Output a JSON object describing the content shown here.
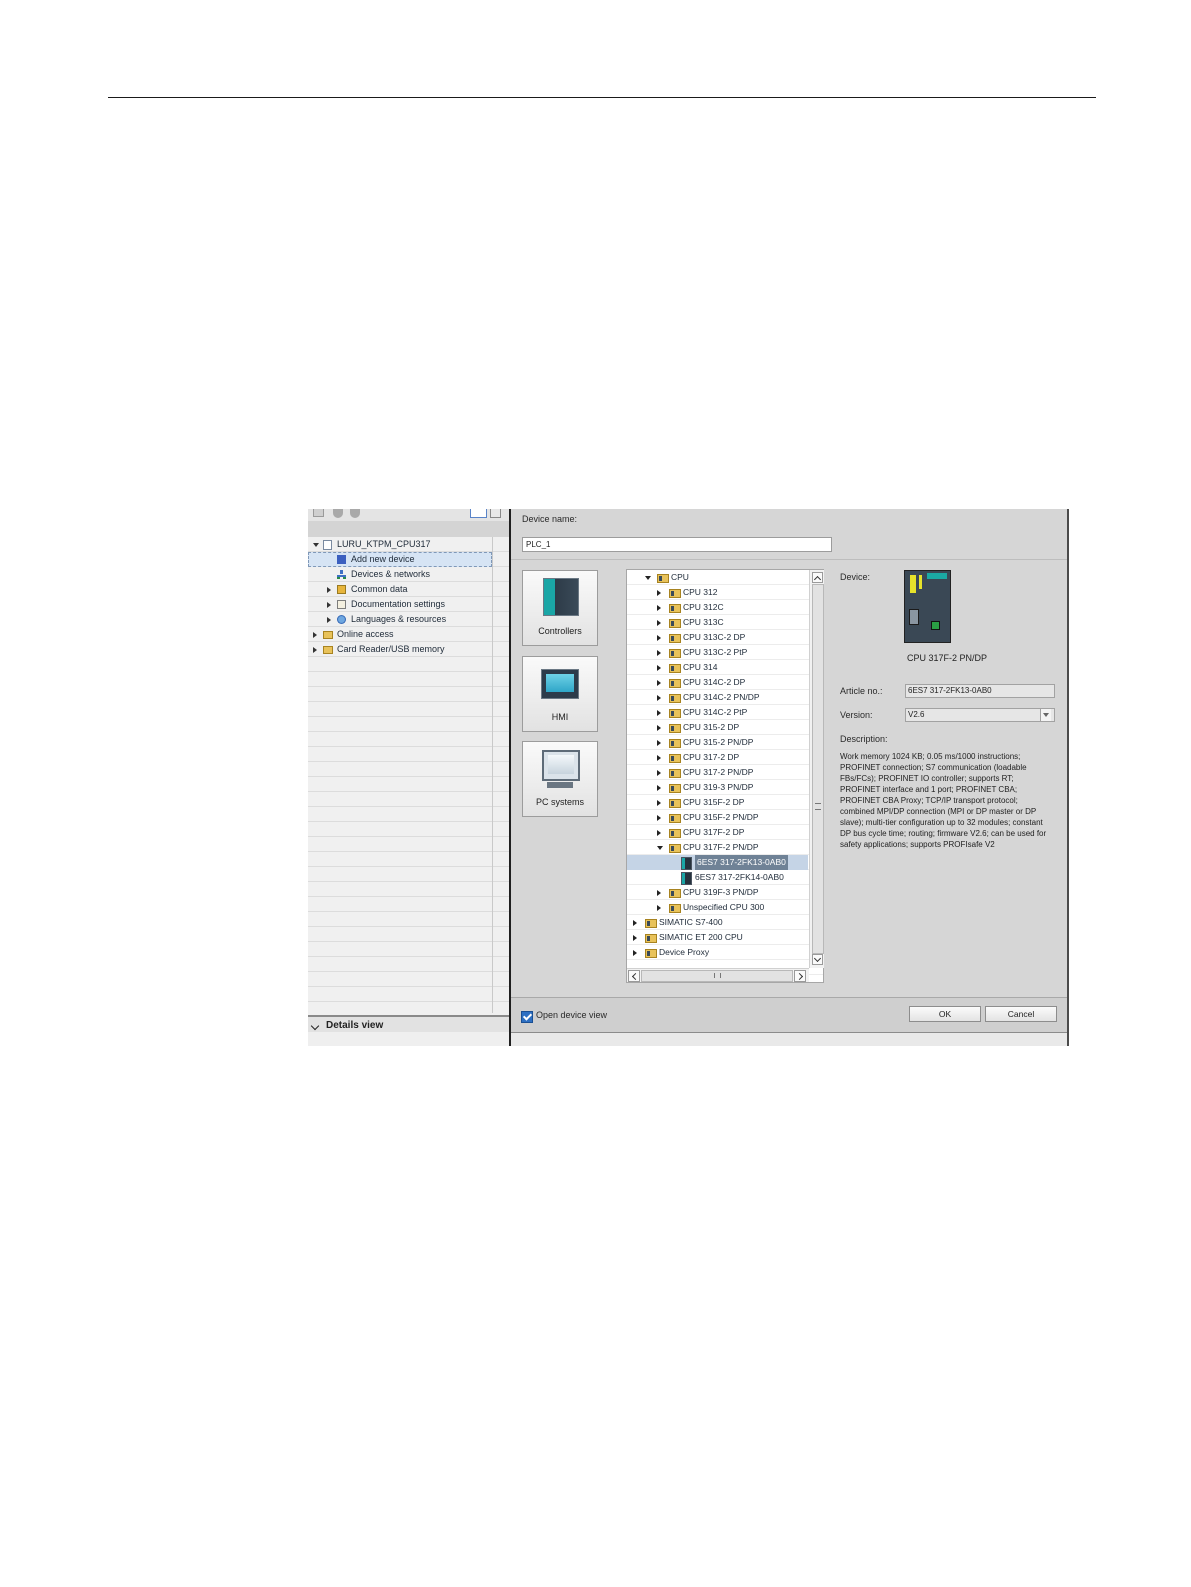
{
  "project_tree": {
    "items": [
      {
        "label": "LURU_KTPM_CPU317",
        "level": 0,
        "state": "expanded",
        "icon": "project-icon"
      },
      {
        "label": "Add new device",
        "level": 1,
        "state": "leaf",
        "icon": "add-device-icon",
        "selected": true
      },
      {
        "label": "Devices & networks",
        "level": 1,
        "state": "leaf",
        "icon": "network-icon"
      },
      {
        "label": "Common data",
        "level": 1,
        "state": "collapsed",
        "icon": "common-data-icon"
      },
      {
        "label": "Documentation settings",
        "level": 1,
        "state": "collapsed",
        "icon": "documentation-icon"
      },
      {
        "label": "Languages & resources",
        "level": 1,
        "state": "collapsed",
        "icon": "languages-icon"
      },
      {
        "label": "Online access",
        "level": 0,
        "state": "collapsed",
        "icon": "online-access-icon"
      },
      {
        "label": "Card Reader/USB memory",
        "level": 0,
        "state": "collapsed",
        "icon": "card-reader-icon"
      }
    ],
    "details_view_label": "Details view"
  },
  "dialog": {
    "device_name_label": "Device name:",
    "device_name_value": "PLC_1",
    "categories": [
      {
        "label": "Controllers",
        "icon": "controller-icon"
      },
      {
        "label": "HMI",
        "icon": "hmi-icon"
      },
      {
        "label": "PC systems",
        "icon": "pc-icon"
      }
    ],
    "catalog": [
      {
        "label": "CPU",
        "level": 0,
        "state": "expanded",
        "icon": "folder"
      },
      {
        "label": "CPU 312",
        "level": 1,
        "state": "collapsed",
        "icon": "folder"
      },
      {
        "label": "CPU 312C",
        "level": 1,
        "state": "collapsed",
        "icon": "folder"
      },
      {
        "label": "CPU 313C",
        "level": 1,
        "state": "collapsed",
        "icon": "folder"
      },
      {
        "label": "CPU 313C-2 DP",
        "level": 1,
        "state": "collapsed",
        "icon": "folder"
      },
      {
        "label": "CPU 313C-2 PtP",
        "level": 1,
        "state": "collapsed",
        "icon": "folder"
      },
      {
        "label": "CPU 314",
        "level": 1,
        "state": "collapsed",
        "icon": "folder"
      },
      {
        "label": "CPU 314C-2 DP",
        "level": 1,
        "state": "collapsed",
        "icon": "folder"
      },
      {
        "label": "CPU 314C-2 PN/DP",
        "level": 1,
        "state": "collapsed",
        "icon": "folder"
      },
      {
        "label": "CPU 314C-2 PtP",
        "level": 1,
        "state": "collapsed",
        "icon": "folder"
      },
      {
        "label": "CPU 315-2 DP",
        "level": 1,
        "state": "collapsed",
        "icon": "folder"
      },
      {
        "label": "CPU 315-2 PN/DP",
        "level": 1,
        "state": "collapsed",
        "icon": "folder"
      },
      {
        "label": "CPU 317-2 DP",
        "level": 1,
        "state": "collapsed",
        "icon": "folder"
      },
      {
        "label": "CPU 317-2 PN/DP",
        "level": 1,
        "state": "collapsed",
        "icon": "folder"
      },
      {
        "label": "CPU 319-3 PN/DP",
        "level": 1,
        "state": "collapsed",
        "icon": "folder"
      },
      {
        "label": "CPU 315F-2 DP",
        "level": 1,
        "state": "collapsed",
        "icon": "folder"
      },
      {
        "label": "CPU 315F-2 PN/DP",
        "level": 1,
        "state": "collapsed",
        "icon": "folder"
      },
      {
        "label": "CPU 317F-2 DP",
        "level": 1,
        "state": "collapsed",
        "icon": "folder"
      },
      {
        "label": "CPU 317F-2 PN/DP",
        "level": 1,
        "state": "expanded",
        "icon": "folder"
      },
      {
        "label": "6ES7 317-2FK13-0AB0",
        "level": 2,
        "state": "leaf",
        "icon": "module",
        "selected": true
      },
      {
        "label": "6ES7 317-2FK14-0AB0",
        "level": 2,
        "state": "leaf",
        "icon": "module"
      },
      {
        "label": "CPU 319F-3 PN/DP",
        "level": 1,
        "state": "collapsed",
        "icon": "folder"
      },
      {
        "label": "Unspecified CPU 300",
        "level": 1,
        "state": "collapsed",
        "icon": "folder"
      },
      {
        "label": "SIMATIC S7-400",
        "level": -1,
        "state": "collapsed",
        "icon": "folder"
      },
      {
        "label": "SIMATIC ET 200 CPU",
        "level": -1,
        "state": "collapsed",
        "icon": "folder"
      },
      {
        "label": "Device Proxy",
        "level": -1,
        "state": "collapsed",
        "icon": "folder"
      }
    ],
    "scroll_grip": "≡",
    "hscroll_grip": "III",
    "info": {
      "device_label": "Device:",
      "device_name": "CPU 317F-2 PN/DP",
      "article_label": "Article no.:",
      "article_value": "6ES7 317-2FK13-0AB0",
      "version_label": "Version:",
      "version_value": "V2.6",
      "description_label": "Description:",
      "description": "Work memory 1024 KB; 0.05 ms/1000 instructions; PROFINET connection; S7 communication (loadable FBs/FCs); PROFINET IO controller; supports RT; PROFINET interface and 1 port; PROFINET CBA; PROFINET CBA Proxy; TCP/IP transport protocol; combined MPI/DP connection (MPI or DP master or DP slave); multi-tier configuration up to 32 modules; constant DP bus cycle time; routing; firmware V2.6; can be used for safety applications; supports PROFIsafe V2"
    },
    "open_device_view_label": "Open device view",
    "open_device_view_checked": true,
    "ok_label": "OK",
    "cancel_label": "Cancel"
  }
}
